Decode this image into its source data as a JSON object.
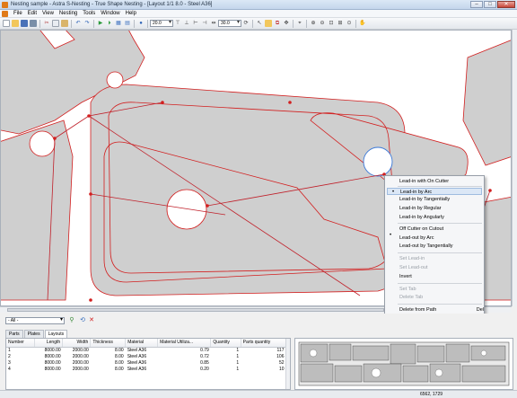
{
  "window": {
    "title": "Nesting sample - Astra S-Nesting - True Shape Nesting - [Layout 1/1 8.0 - Steel A36]",
    "controls": [
      "–",
      "□",
      "✕"
    ]
  },
  "menu": [
    "File",
    "Edit",
    "View",
    "Nesting",
    "Tools",
    "Window",
    "Help"
  ],
  "toolbar": {
    "zoom_value": "20.0",
    "angle_value": "30.0"
  },
  "context_menu": {
    "items": [
      {
        "label": "Lead-in with On Cutter",
        "checked": false,
        "disabled": false
      },
      {
        "label": "Lead-in by Arc",
        "checked": true,
        "disabled": false,
        "highlighted": true
      },
      {
        "label": "Lead-in by Tangentially",
        "checked": false,
        "disabled": false
      },
      {
        "label": "Lead-in by Regular",
        "checked": false,
        "disabled": false
      },
      {
        "label": "Lead-in by Angularly",
        "checked": false,
        "disabled": false
      },
      {
        "label": "Off Cutter on Cutout",
        "checked": false,
        "disabled": false
      },
      {
        "label": "Lead-out by Arc",
        "checked": true,
        "disabled": false
      },
      {
        "label": "Lead-out by Tangentially",
        "checked": false,
        "disabled": false
      },
      {
        "label": "Set Lead-in",
        "checked": false,
        "disabled": true
      },
      {
        "label": "Set Lead-out",
        "checked": false,
        "disabled": true
      },
      {
        "label": "Invert",
        "checked": false,
        "disabled": false
      },
      {
        "label": "Set Tab",
        "checked": false,
        "disabled": true
      },
      {
        "label": "Delete Tab",
        "checked": false,
        "disabled": true
      },
      {
        "label": "Delete from Path",
        "checked": false,
        "disabled": false,
        "shortcut": "Del"
      }
    ]
  },
  "filter": {
    "value": "- All -"
  },
  "tabs": [
    {
      "label": "Parts",
      "active": false
    },
    {
      "label": "Plates",
      "active": false
    },
    {
      "label": "Layouts",
      "active": true
    }
  ],
  "layouts_table": {
    "columns": [
      "Number",
      "Length",
      "Width",
      "Thickness",
      "Material",
      "Material Utiliza...",
      "Quantity",
      "Parts quantity"
    ],
    "rows": [
      [
        "1",
        "8000.00",
        "2000.00",
        "8.00",
        "Steel A36",
        "0.79",
        "1",
        "117"
      ],
      [
        "2",
        "8000.00",
        "2000.00",
        "8.00",
        "Steel A36",
        "0.72",
        "1",
        "106"
      ],
      [
        "3",
        "8000.00",
        "2000.00",
        "8.00",
        "Steel A36",
        "0.85",
        "1",
        "52"
      ],
      [
        "4",
        "8000.00",
        "2000.00",
        "8.00",
        "Steel A36",
        "0.20",
        "1",
        "10"
      ]
    ]
  },
  "status": {
    "coords": "6562, 1729"
  },
  "colors": {
    "part_fill": "#cfcfcf",
    "part_outline": "#d21f1f",
    "path_line": "#c0202a",
    "selected_hole": "#3a78d8"
  }
}
